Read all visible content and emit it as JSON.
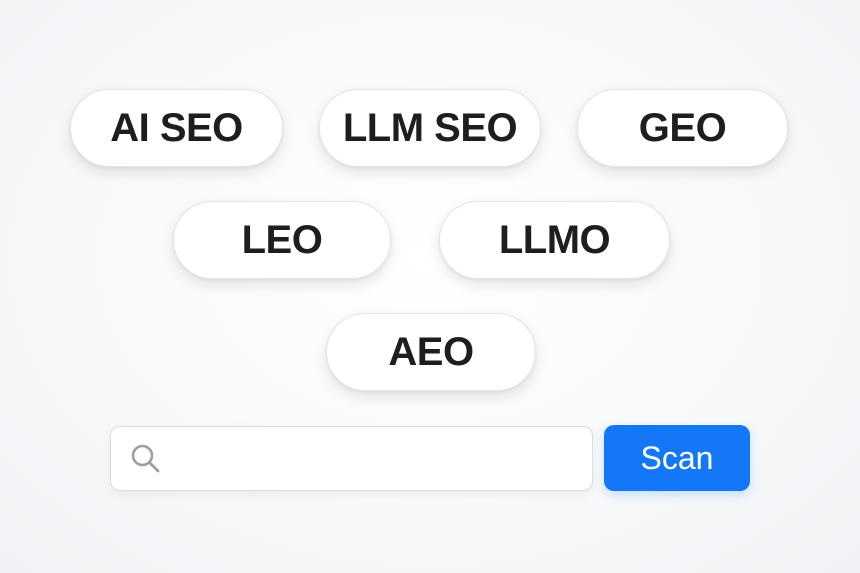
{
  "tags": [
    {
      "id": "pill-ai-seo",
      "label": "AI SEO"
    },
    {
      "id": "pill-llm-seo",
      "label": "LLM SEO"
    },
    {
      "id": "pill-geo",
      "label": "GEO"
    },
    {
      "id": "pill-leo",
      "label": "LEO"
    },
    {
      "id": "pill-llmo",
      "label": "LLMO"
    },
    {
      "id": "pill-aeo",
      "label": "AEO"
    }
  ],
  "search": {
    "value": "",
    "placeholder": "",
    "icon": "search-icon"
  },
  "scan_button": {
    "label": "Scan"
  },
  "colors": {
    "accent": "#1477f8",
    "pill_text": "#1d1e22",
    "pill_border": "#e3e5e9",
    "background": "#f6f7f9"
  }
}
